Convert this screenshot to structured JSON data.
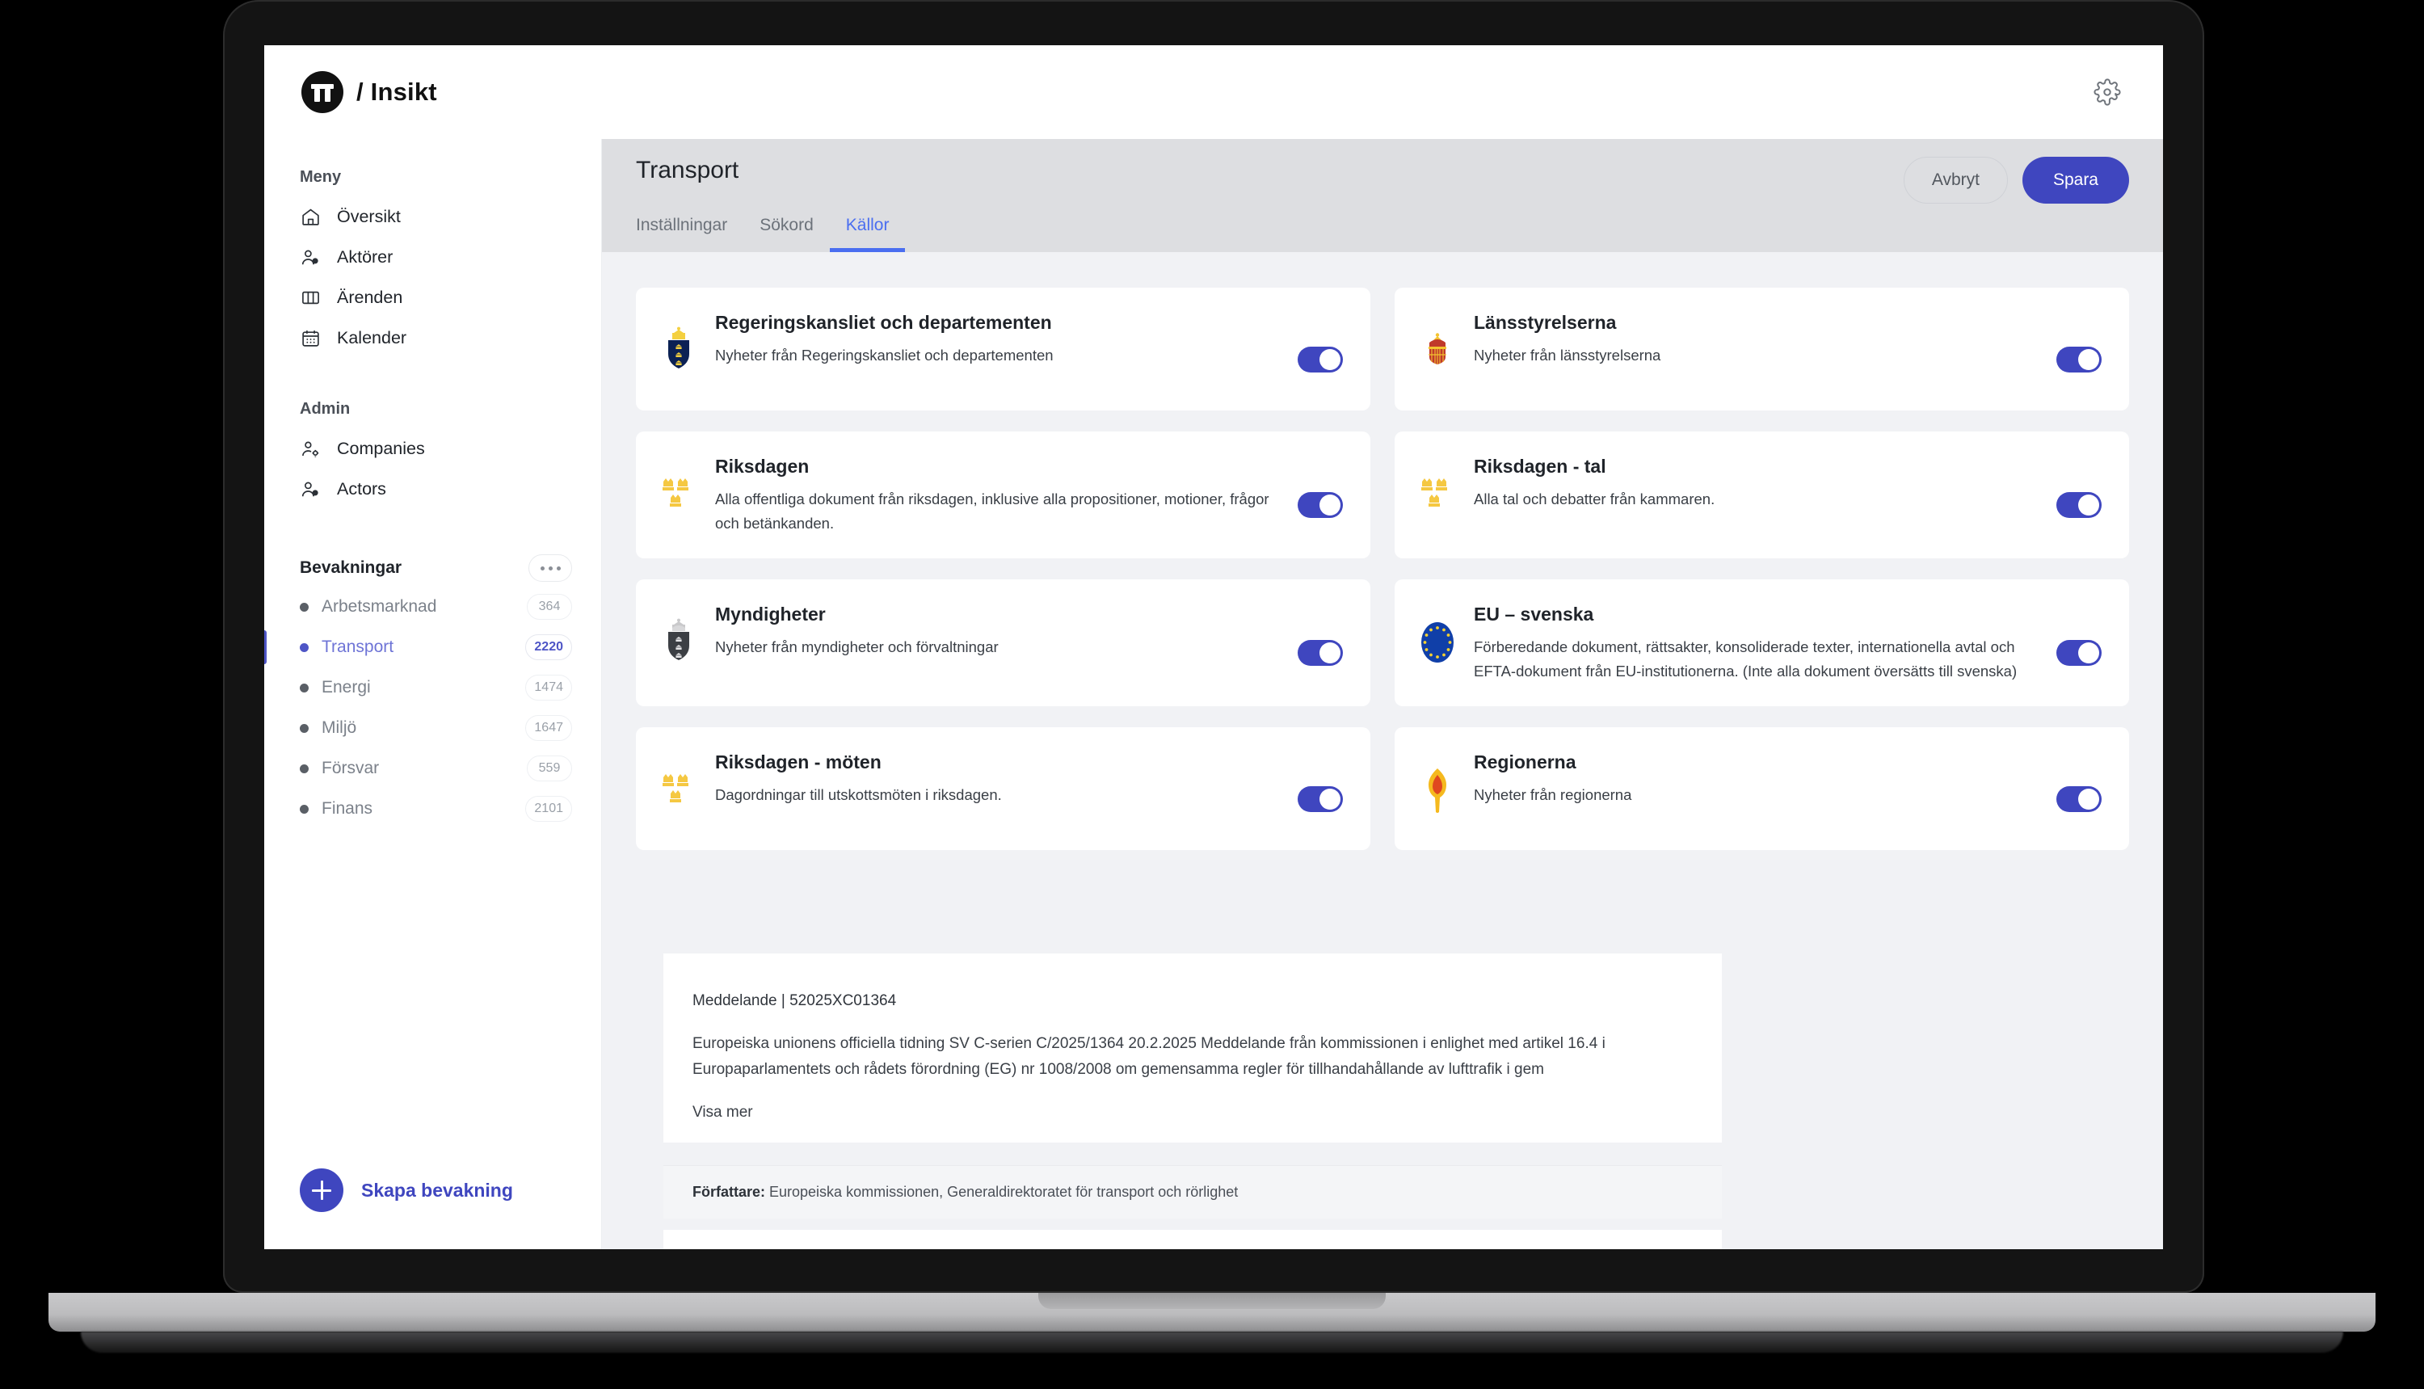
{
  "topbar": {
    "brand_mark": "tt-logo-icon",
    "brand_text": "/ Insikt",
    "settings_icon": "gear-icon"
  },
  "sidebar": {
    "menu_label": "Meny",
    "menu_items": [
      {
        "label": "Översikt",
        "icon": "home-icon"
      },
      {
        "label": "Aktörer",
        "icon": "users-icon"
      },
      {
        "label": "Ärenden",
        "icon": "columns-icon"
      },
      {
        "label": "Kalender",
        "icon": "calendar-icon"
      }
    ],
    "admin_label": "Admin",
    "admin_items": [
      {
        "label": "Companies",
        "icon": "user-gear-icon"
      },
      {
        "label": "Actors",
        "icon": "users-icon"
      }
    ],
    "watch_label": "Bevakningar",
    "watch_more_icon": "more-dots-icon",
    "watch_items": [
      {
        "label": "Arbetsmarknad",
        "count": "364",
        "active": false
      },
      {
        "label": "Transport",
        "count": "2220",
        "active": true
      },
      {
        "label": "Energi",
        "count": "1474",
        "active": false
      },
      {
        "label": "Miljö",
        "count": "1647",
        "active": false
      },
      {
        "label": "Försvar",
        "count": "559",
        "active": false
      },
      {
        "label": "Finans",
        "count": "2101",
        "active": false
      }
    ],
    "create_button": "Skapa bevakning",
    "create_icon": "plus-icon"
  },
  "main": {
    "page_title": "Transport",
    "cancel_label": "Avbryt",
    "save_label": "Spara",
    "tabs": [
      {
        "label": "Inställningar",
        "active": false
      },
      {
        "label": "Sökord",
        "active": false
      },
      {
        "label": "Källor",
        "active": true
      }
    ]
  },
  "sources": [
    {
      "title": "Regeringskansliet och departementen",
      "description": "Nyheter från Regeringskansliet och departementen",
      "icon": "swedish-coat-of-arms-icon",
      "enabled": true
    },
    {
      "title": "Länsstyrelserna",
      "description": "Nyheter från länsstyrelserna",
      "icon": "red-crown-icon",
      "enabled": true
    },
    {
      "title": "Riksdagen",
      "description": "Alla offentliga dokument från riksdagen, inklusive alla propositioner, motioner, frågor och betänkanden.",
      "icon": "three-crowns-icon",
      "enabled": true
    },
    {
      "title": "Riksdagen - tal",
      "description": "Alla tal och debatter från kammaren.",
      "icon": "three-crowns-icon",
      "enabled": true
    },
    {
      "title": "Myndigheter",
      "description": "Nyheter från myndigheter och förvaltningar",
      "icon": "grey-coat-of-arms-icon",
      "enabled": true
    },
    {
      "title": "EU – svenska",
      "description": "Förberedande dokument, rättsakter, konsoliderade texter, internationella avtal och EFTA-dokument från EU-institutionerna. (Inte alla dokument översätts till svenska)",
      "icon": "eu-flag-icon",
      "enabled": true
    },
    {
      "title": "Riksdagen - möten",
      "description": "Dagordningar till utskottsmöten i riksdagen.",
      "icon": "three-crowns-icon",
      "enabled": true
    },
    {
      "title": "Regionerna",
      "description": "Nyheter från regionerna",
      "icon": "region-flame-icon",
      "enabled": true
    }
  ],
  "behind_document": {
    "meta": "Meddelande | 52025XC01364",
    "body_line1": "Europeiska unionens officiella tidning SV C-serien C/2025/1364 20.2.2025 Meddelande från kommissionen i enlighet med artikel 16.4 i",
    "body_line2": "Europaparlamentets och rådets förordning (EG) nr 1008/2008 om gemensamma regler för tillhandahållande av lufttrafik i gem",
    "show_more": "Visa mer",
    "author_label": "Författare:",
    "author_value": " Europeiska kommissionen, Generaldirektoratet för transport och rörlighet"
  },
  "colors": {
    "accent": "#3f46bf",
    "tab_active": "#4a6ef0",
    "header_band": "#dddee1",
    "canvas": "#f1f2f5"
  }
}
